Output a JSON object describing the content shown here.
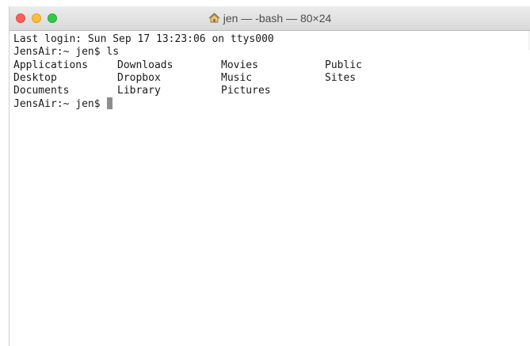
{
  "window": {
    "title": "jen — -bash — 80×24",
    "title_icon": "home-icon",
    "controls": [
      "close",
      "minimize",
      "maximize"
    ],
    "colors": {
      "close": "#fc605b",
      "minimize": "#fdbc40",
      "maximize": "#34c84a",
      "cursor": "#8e8e8e",
      "text": "#1a1a1a"
    }
  },
  "terminal": {
    "last_login": "Last login: Sun Sep 17 13:23:06 on ttys000",
    "prompt_command": "JensAir:~ jen$ ls",
    "listing": [
      [
        "Applications",
        "Downloads",
        "Movies",
        "Public"
      ],
      [
        "Desktop",
        "Dropbox",
        "Music",
        "Sites"
      ],
      [
        "Documents",
        "Library",
        "Pictures",
        ""
      ]
    ],
    "prompt": "JensAir:~ jen$ "
  }
}
